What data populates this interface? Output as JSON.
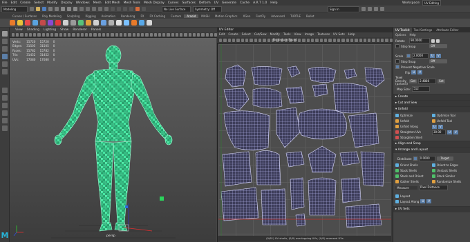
{
  "menubar": {
    "items": [
      "File",
      "Edit",
      "Create",
      "Select",
      "Modify",
      "Display",
      "Windows",
      "Mesh",
      "Edit Mesh",
      "Mesh Tools",
      "Mesh Display",
      "Curves",
      "Surfaces",
      "Deform",
      "UV",
      "Generate",
      "Cache",
      "A.R.T 1.0",
      "Help"
    ],
    "workspace_label": "Workspace:",
    "workspace_value": "UV Editing"
  },
  "statusline": {
    "mode": "Modeling",
    "live_surface": "No Live Surface",
    "symmetry": "Symmetry: Off",
    "sign_in": "Sign In"
  },
  "shelf": {
    "tabs": [
      "Curves / Surfaces",
      "Poly Modeling",
      "Sculpting",
      "Rigging",
      "Animation",
      "Rendering",
      "FX",
      "FX Caching",
      "Custom",
      "Arnold",
      "MASH",
      "Motion Graphics",
      "XGen",
      "FastFly",
      "Advanced",
      "TURTLE",
      "Bullet"
    ],
    "active_tab": "Arnold",
    "icon_colors": [
      "#e87a2a",
      "#e8c23a",
      "#e84a4a",
      "#5aa4e0",
      "#c44a4a",
      "#8a4ad0",
      "#e03a3a",
      "#cfcfcf",
      "#9a9a9a",
      "#58c27a",
      "#e0a03a",
      "#d0d0d0",
      "#6aa0e0",
      "#b0b0b0",
      "#e0e0e0",
      "#7bc0ff",
      "#e87a2a",
      "#58a8e8",
      "#d6d6d6"
    ]
  },
  "viewport": {
    "menu": [
      "View",
      "Shading",
      "Lighting",
      "Show",
      "Renderer",
      "Panels"
    ],
    "hud": {
      "rows": [
        {
          "label": "Verts:",
          "a": "15720",
          "b": "15720",
          "c": "0"
        },
        {
          "label": "Edges:",
          "a": "31505",
          "b": "31505",
          "c": "0"
        },
        {
          "label": "Faces:",
          "a": "15782",
          "b": "15782",
          "c": "0"
        },
        {
          "label": "Tris:",
          "a": "31452",
          "b": "31452",
          "c": "0"
        },
        {
          "label": "UVs:",
          "a": "17080",
          "b": "17080",
          "c": "0"
        }
      ]
    },
    "camera_label": "persp",
    "mesh_color": "#3de29a"
  },
  "uv_editor": {
    "title": "UV Editor",
    "menu": [
      "Edit",
      "Create",
      "Select",
      "Cut/Sew",
      "Modify",
      "Tools",
      "View",
      "Image",
      "Textures",
      "UV Sets",
      "Help"
    ],
    "no_texture": "No texture Found",
    "status": "(0/61) UV shells, (0/0) overlapping UVs, (0/0) reversed UVs"
  },
  "uv_toolkit": {
    "tabs": [
      "UV Toolkit",
      "Tool Settings",
      "Attribute Editor"
    ],
    "active_tab": "UV Toolkit",
    "sub_menu": [
      "Options",
      "Help"
    ],
    "rotate_label": "Rotate",
    "rotate_value": "90.0000",
    "step_snap_label": "Step Snap",
    "step_snap_value": "Off",
    "scale_label": "Scale",
    "scale_value": "2.0000",
    "u_label": "U",
    "v_label": "V",
    "prevent_negative_scale": "Prevent Negative Scale",
    "flip_label": "Flip",
    "texel_density_label": "Texel Density (px/unit)",
    "get_label": "Get",
    "texel_value": "2.4886",
    "set_label": "Set",
    "map_size_label": "Map Size:",
    "map_size_value": "512",
    "sections": {
      "create": "Create",
      "cut_and_sew": "Cut and Sew",
      "unfold": "Unfold",
      "align_snap": "Align and Snap",
      "arrange_layout": "Arrange and Layout",
      "measure": "Measure",
      "uv_sets": "UV Sets"
    },
    "unfold_items": [
      "Optimize",
      "Optimize Tool",
      "Unfold",
      "Unfold Tool",
      "Unfold Along",
      "U",
      "V",
      "Straighten UVs",
      "Straighten Shell"
    ],
    "straighten_value": "30.00",
    "distribute_label": "Distribute",
    "distribute_value": "0.0000",
    "target_label": "Target",
    "layout_items": [
      "Orient Shells",
      "Orient to Edges",
      "Stack Shells",
      "Unstack Shells",
      "Stack and Orient",
      "Stack Similar",
      "Gather Shells",
      "Randomize Shells"
    ],
    "measure_value": "Pixel Distance",
    "layout_label": "Layout",
    "layout_along_label": "Layout Along"
  },
  "colors": {
    "accent_blue": "#5c7fa8",
    "uv_wire": "#b8b8ff",
    "mesh_green": "#3de29a"
  }
}
